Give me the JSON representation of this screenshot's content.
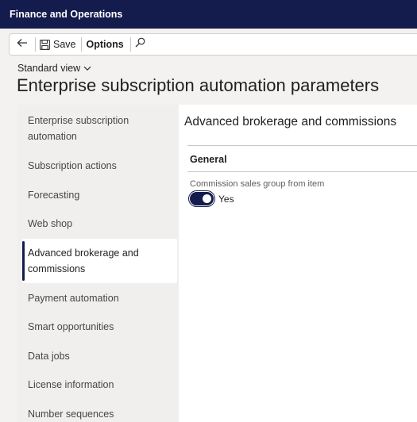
{
  "app": {
    "title": "Finance and Operations"
  },
  "toolbar": {
    "save_label": "Save",
    "options_label": "Options",
    "back_icon": "back-arrow-icon",
    "save_icon": "save-icon",
    "search_icon": "search-icon"
  },
  "view": {
    "label": "Standard view"
  },
  "page": {
    "title": "Enterprise subscription automation parameters"
  },
  "nav": {
    "items": [
      {
        "label": "Enterprise subscription automation"
      },
      {
        "label": "Subscription actions"
      },
      {
        "label": "Forecasting"
      },
      {
        "label": "Web shop"
      },
      {
        "label": "Advanced brokerage and commissions",
        "selected": true
      },
      {
        "label": "Payment automation"
      },
      {
        "label": "Smart opportunities"
      },
      {
        "label": "Data jobs"
      },
      {
        "label": "License information"
      },
      {
        "label": "Number sequences"
      }
    ]
  },
  "detail": {
    "title": "Advanced brokerage and commissions",
    "section": {
      "header": "General"
    },
    "field": {
      "label": "Commission sales group from item",
      "value_text": "Yes",
      "value": true
    }
  },
  "colors": {
    "accent": "#141b4d",
    "nav_background": "#f0efee"
  }
}
